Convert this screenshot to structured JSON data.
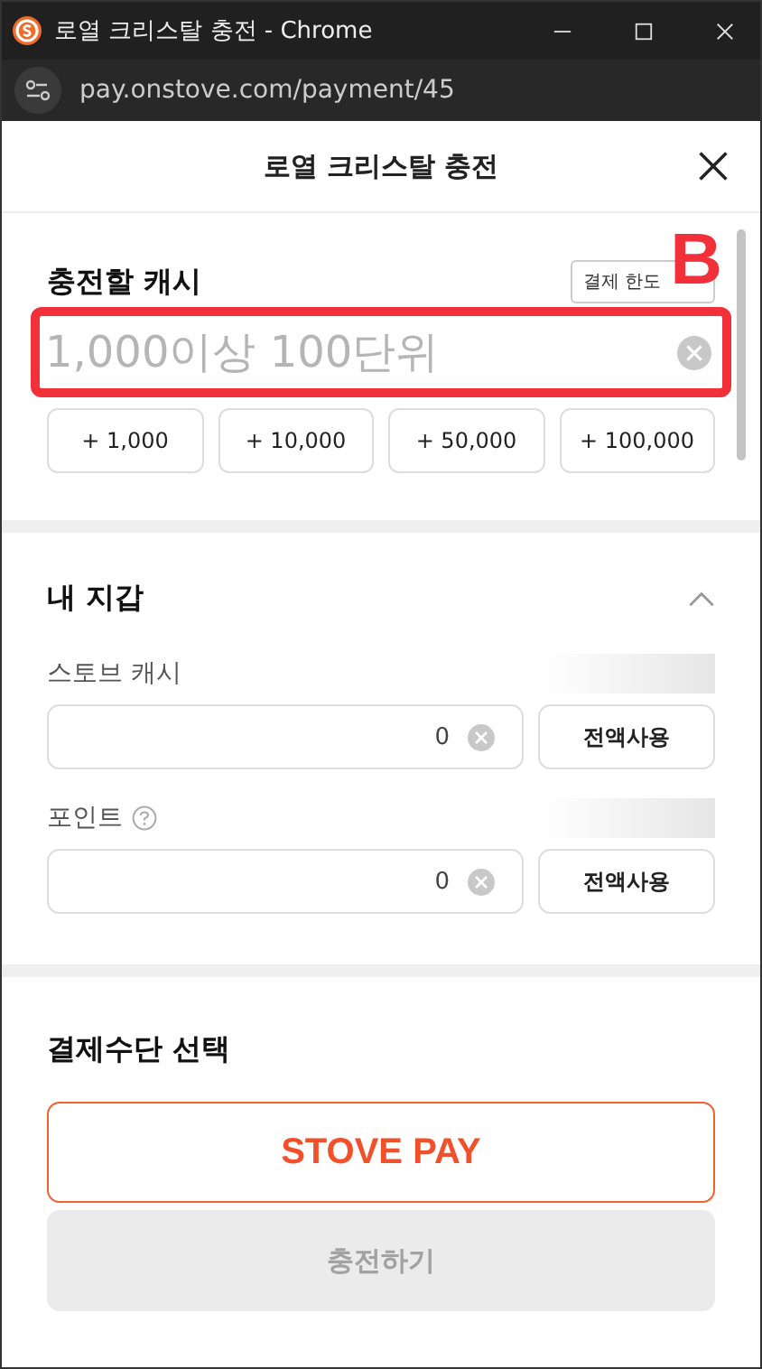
{
  "window": {
    "title": "로열 크리스탈 충전 - Chrome",
    "url": "pay.onstove.com/payment/45"
  },
  "header": {
    "title": "로열 크리스탈 충전"
  },
  "charge": {
    "label": "충전할 캐시",
    "limit_button": "결제 한도",
    "annotation": "B",
    "placeholder": "1,000이상 100단위",
    "amounts": [
      "+ 1,000",
      "+ 10,000",
      "+ 50,000",
      "+ 100,000"
    ]
  },
  "wallet": {
    "title": "내 지갑",
    "expanded": true,
    "items": [
      {
        "label": "스토브 캐시",
        "help": false,
        "value": "0",
        "button": "전액사용"
      },
      {
        "label": "포인트",
        "help": true,
        "value": "0",
        "button": "전액사용"
      }
    ]
  },
  "payment": {
    "title": "결제수단 선택",
    "methods": [
      {
        "label": "STOVE PAY",
        "selected": true
      }
    ],
    "submit": {
      "label": "충전하기",
      "disabled": true
    }
  }
}
